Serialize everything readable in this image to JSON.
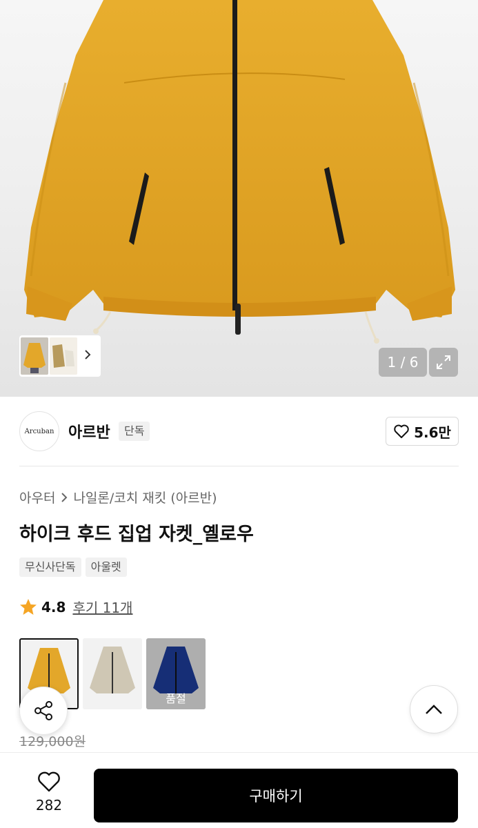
{
  "gallery": {
    "counter": "1 / 6",
    "thumb_next_icon": "chevron-right-icon",
    "expand_icon": "expand-icon"
  },
  "brand": {
    "logo_text": "Arcuban",
    "name": "아르반",
    "tag": "단독",
    "like_icon": "heart-outline-icon",
    "like_count": "5.6만"
  },
  "breadcrumb": {
    "category": "아우터",
    "separator_icon": "chevron-right-icon",
    "subcategory": "나일론/코치 재킷 (아르반)"
  },
  "product": {
    "title": "하이크 후드 집업 자켓_옐로우",
    "tags": [
      "무신사단독",
      "아울렛"
    ],
    "rating": "4.8",
    "reviews": "후기 11개",
    "original_price": "129,000원"
  },
  "variants": [
    {
      "color": "#E3A72A",
      "selected": true
    },
    {
      "color": "#CFC7B4",
      "selected": false
    },
    {
      "color": "#1E3E9E",
      "selected": false,
      "label": "품절"
    }
  ],
  "bottom": {
    "wish_count": "282",
    "buy_label": "구매하기"
  },
  "colors": {
    "jacket": "#E3A72A",
    "star": "#F5A524",
    "button": "#000000"
  }
}
